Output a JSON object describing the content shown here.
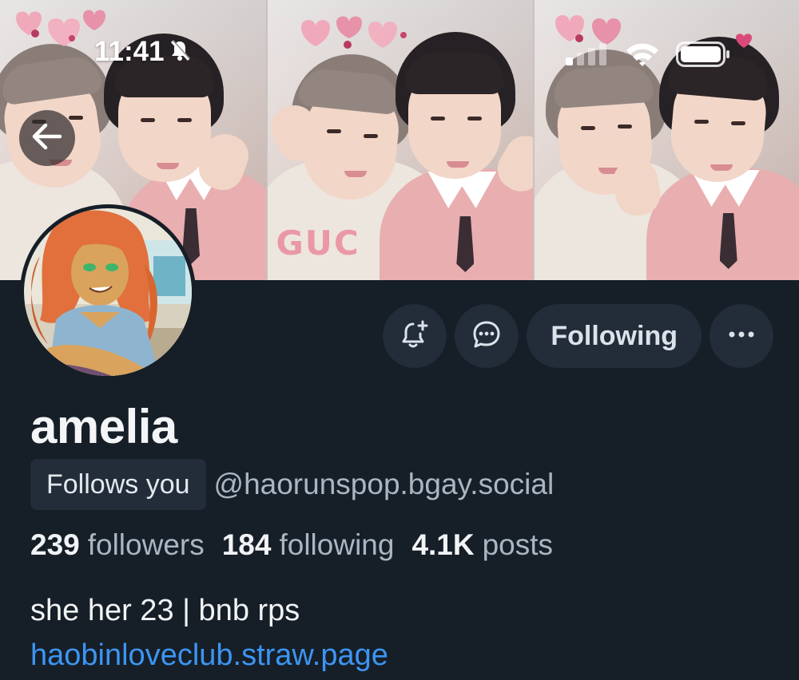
{
  "status_bar": {
    "time": "11:41",
    "icons": [
      "bell-slash-icon",
      "signal-icon",
      "wifi-icon",
      "battery-icon"
    ]
  },
  "banner": {
    "panels": 3,
    "hoodie_print": "GUC"
  },
  "navigation": {
    "back_icon": "arrow-left-icon"
  },
  "actions": {
    "subscribe_icon": "bell-plus-icon",
    "message_icon": "chat-bubble-icon",
    "follow_label": "Following",
    "more_icon": "ellipsis-icon"
  },
  "profile": {
    "display_name": "amelia",
    "follows_you_label": "Follows you",
    "handle": "@haorunspop.bgay.social",
    "stats": {
      "followers_count": "239",
      "followers_label": "followers",
      "following_count": "184",
      "following_label": "following",
      "posts_count": "4.1K",
      "posts_label": "posts"
    },
    "bio": "she her 23 | bnb rps",
    "link": "haobinloveclub.straw.page"
  },
  "colors": {
    "background": "#161e27",
    "button_bg": "#222d39",
    "muted_text": "#a9b6c4",
    "link": "#3c95f2"
  }
}
